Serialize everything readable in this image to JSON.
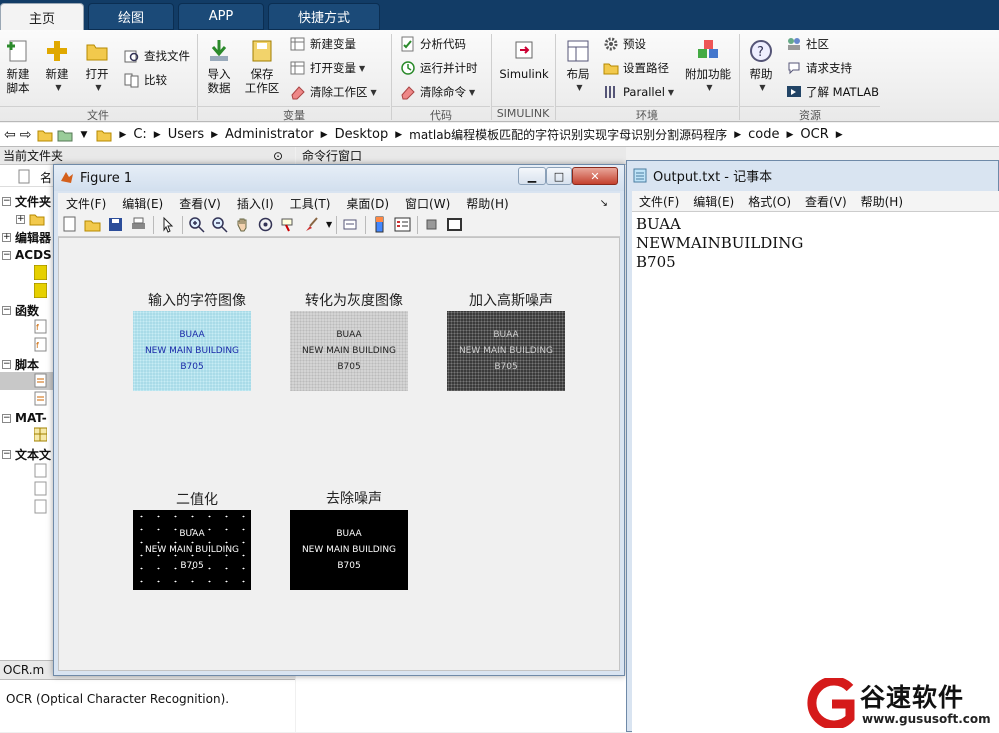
{
  "tabs": [
    {
      "label": "主页",
      "active": true
    },
    {
      "label": "绘图",
      "active": false
    },
    {
      "label": "APP",
      "active": false
    },
    {
      "label": "快捷方式",
      "active": false
    }
  ],
  "ribbon": {
    "file": {
      "new_script": "新建\n脚本",
      "new": "新建",
      "open": "打开",
      "find_files": "查找文件",
      "compare": "比较",
      "group": "文件"
    },
    "variable": {
      "import": "导入\n数据",
      "save_ws": "保存\n工作区",
      "new_var": "新建变量",
      "open_var": "打开变量",
      "clear_ws": "清除工作区",
      "group": "变量"
    },
    "code": {
      "analyze": "分析代码",
      "run_time": "运行并计时",
      "clear_cmd": "清除命令",
      "group": "代码"
    },
    "simulink": {
      "label": "Simulink",
      "group": "SIMULINK"
    },
    "env": {
      "layout": "布局",
      "prefs": "预设",
      "set_path": "设置路径",
      "parallel": "Parallel",
      "addons": "附加功能",
      "group": "环境"
    },
    "resources": {
      "help": "帮助",
      "community": "社区",
      "support": "请求支持",
      "learn": "了解 MATLAB",
      "group": "资源"
    }
  },
  "address": {
    "crumbs": [
      "C:",
      "Users",
      "Administrator",
      "Desktop",
      "matlab编程模板匹配的字符识别实现字母识别分割源码程序",
      "code",
      "OCR"
    ]
  },
  "left_panel": {
    "header": "当前文件夹",
    "col_name": "名",
    "sections": [
      "文件夹",
      "编辑器",
      "ACDS",
      "函数",
      "脚本",
      "MAT-",
      "文本文"
    ],
    "file_name": "OCR.m",
    "description": "OCR (Optical Character Recognition)."
  },
  "command_window": {
    "header": "命令行窗口"
  },
  "figure": {
    "title": "Figure 1",
    "menu": [
      "文件(F)",
      "编辑(E)",
      "查看(V)",
      "插入(I)",
      "工具(T)",
      "桌面(D)",
      "窗口(W)",
      "帮助(H)"
    ],
    "toolbar_icons": [
      "new-figure-icon",
      "open-icon",
      "save-icon",
      "print-icon",
      "pointer-icon",
      "zoom-in-icon",
      "zoom-out-icon",
      "pan-icon",
      "rotate-icon",
      "datacursor-icon",
      "brush-icon",
      "link-icon",
      "colorbar-icon",
      "legend-icon",
      "hide-tools-icon",
      "show-tools-icon"
    ],
    "subplots": [
      {
        "title": "输入的字符图像",
        "lines": [
          "BUAA",
          "NEW MAIN BUILDING",
          "B705"
        ],
        "bg": "#a9dbe8",
        "fg": "#1a2aa8"
      },
      {
        "title": "转化为灰度图像",
        "lines": [
          "BUAA",
          "NEW MAIN BUILDING",
          "B705"
        ],
        "bg": "#d4d4d4",
        "fg": "#222222"
      },
      {
        "title": "加入高斯噪声",
        "lines": [
          "BUAA",
          "NEW MAIN BUILDING",
          "B705"
        ],
        "bg": "#3a3a3a",
        "fg": "#cfcfcf"
      },
      {
        "title": "二值化",
        "lines": [
          "BUAA",
          "NEW MAIN BUILDING",
          "B705"
        ],
        "bg": "#000000",
        "fg": "#ffffff"
      },
      {
        "title": "去除噪声",
        "lines": [
          "BUAA",
          "NEW MAIN BUILDING",
          "B705"
        ],
        "bg": "#000000",
        "fg": "#ffffff"
      }
    ]
  },
  "notepad": {
    "title": "Output.txt - 记事本",
    "menu": [
      "文件(F)",
      "编辑(E)",
      "格式(O)",
      "查看(V)",
      "帮助(H)"
    ],
    "lines": [
      "BUAA",
      "NEWMAINBUILDING",
      "B705"
    ]
  },
  "watermark": {
    "brand": "谷速软件",
    "url": "www.gususoft.com"
  }
}
